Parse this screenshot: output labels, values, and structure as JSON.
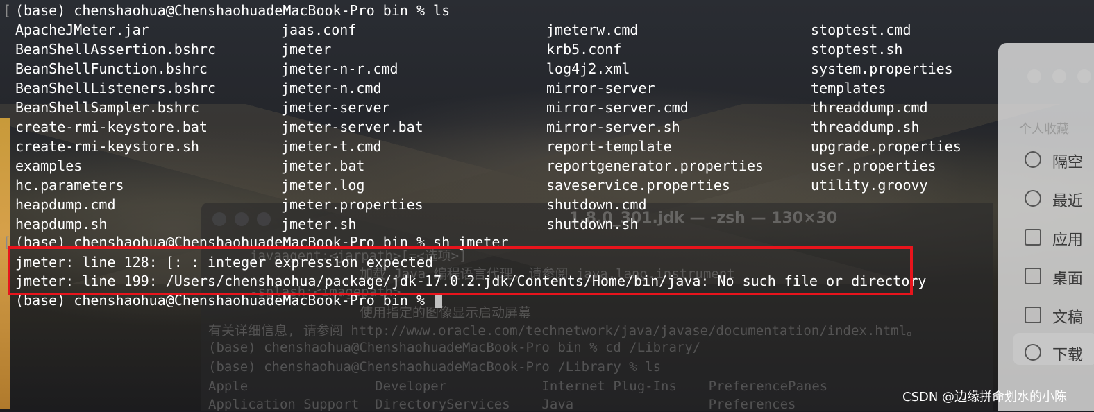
{
  "prompt_ls": "(base) chenshaohua@ChenshaohuadeMacBook-Pro bin % ls",
  "files": [
    [
      "ApacheJMeter.jar",
      "jaas.conf",
      "jmeterw.cmd",
      "stoptest.cmd"
    ],
    [
      "BeanShellAssertion.bshrc",
      "jmeter",
      "krb5.conf",
      "stoptest.sh"
    ],
    [
      "BeanShellFunction.bshrc",
      "jmeter-n-r.cmd",
      "log4j2.xml",
      "system.properties"
    ],
    [
      "BeanShellListeners.bshrc",
      "jmeter-n.cmd",
      "mirror-server",
      "templates"
    ],
    [
      "BeanShellSampler.bshrc",
      "jmeter-server",
      "mirror-server.cmd",
      "threaddump.cmd"
    ],
    [
      "create-rmi-keystore.bat",
      "jmeter-server.bat",
      "mirror-server.sh",
      "threaddump.sh"
    ],
    [
      "create-rmi-keystore.sh",
      "jmeter-t.cmd",
      "report-template",
      "upgrade.properties"
    ],
    [
      "examples",
      "jmeter.bat",
      "reportgenerator.properties",
      "user.properties"
    ],
    [
      "hc.parameters",
      "jmeter.log",
      "saveservice.properties",
      "utility.groovy"
    ],
    [
      "heapdump.cmd",
      "jmeter.properties",
      "shutdown.cmd",
      ""
    ],
    [
      "heapdump.sh",
      "jmeter.sh",
      "shutdown.sh",
      ""
    ]
  ],
  "prompt_sh": "(base) chenshaohua@ChenshaohuadeMacBook-Pro bin % sh jmeter",
  "errors": [
    "jmeter: line 128: [: : integer expression expected",
    "jmeter: line 199: /Users/chenshaohua/package/jdk-17.0.2.jdk/Contents/Home/bin/java: No such file or directory"
  ],
  "prompt_final": "(base) chenshaohua@ChenshaohuadeMacBook-Pro bin %",
  "background_window": {
    "title": "1.8.0_301.jdk — -zsh — 130×30",
    "lines": [
      "javaagent:<jarpath>[=<选项>]",
      "加载 Java 编程语言代理, 请参阅 java.lang.instrument",
      "-splash:<imagepath>",
      "使用指定的图像显示启动屏幕",
      "有关详细信息, 请参阅 http://www.oracle.com/technetwork/java/javase/documentation/index.html。",
      "(base) chenshaohua@ChenshaohuadeMacBook-Pro bin % cd /Library/",
      "(base) chenshaohua@ChenshaohuadeMacBook-Pro /Library % ls",
      "Apple                Developer            Internet Plug-Ins    PreferencePanes",
      "Application Support  DirectoryServices    Java                 Preferences"
    ]
  },
  "finder_sidebar": {
    "section": "个人收藏",
    "items": [
      "隔空",
      "最近",
      "应用",
      "桌面",
      "文稿",
      "下载"
    ]
  },
  "watermark": "CSDN @边缘拼命划水的小陈",
  "colors": {
    "terminal_text": "#ffffff",
    "highlight_border": "#e8141c"
  }
}
